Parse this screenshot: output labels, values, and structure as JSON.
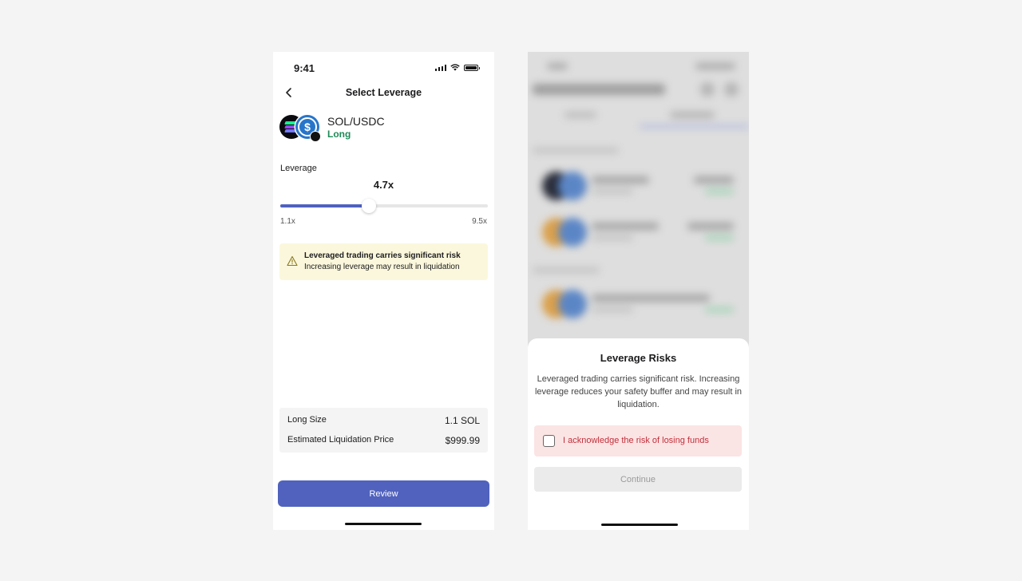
{
  "left": {
    "status_time": "9:41",
    "nav_title": "Select Leverage",
    "pair": {
      "name": "SOL/USDC",
      "side": "Long"
    },
    "leverage": {
      "label": "Leverage",
      "value_text": "4.7x",
      "min_label": "1.1x",
      "max_label": "9.5x",
      "min": 1.1,
      "max": 9.5,
      "value": 4.7
    },
    "warning": {
      "title": "Leveraged trading carries significant risk",
      "body": "Increasing leverage may result in liquidation"
    },
    "summary": [
      {
        "label": "Long Size",
        "value": "1.1 SOL"
      },
      {
        "label": "Estimated Liquidation Price",
        "value": "$999.99"
      }
    ],
    "review_label": "Review"
  },
  "right": {
    "sheet": {
      "title": "Leverage Risks",
      "body": "Leveraged trading carries significant risk. Increasing leverage reduces your safety buffer and may result in liquidation.",
      "ack_label": "I acknowledge the risk of losing funds",
      "ack_checked": false,
      "continue_label": "Continue"
    }
  },
  "colors": {
    "accent": "#5062bd",
    "long_green": "#1f8a58",
    "warning_bg": "#fbf7dc",
    "danger_text": "#c2303b",
    "danger_bg": "#fbe4e4"
  }
}
